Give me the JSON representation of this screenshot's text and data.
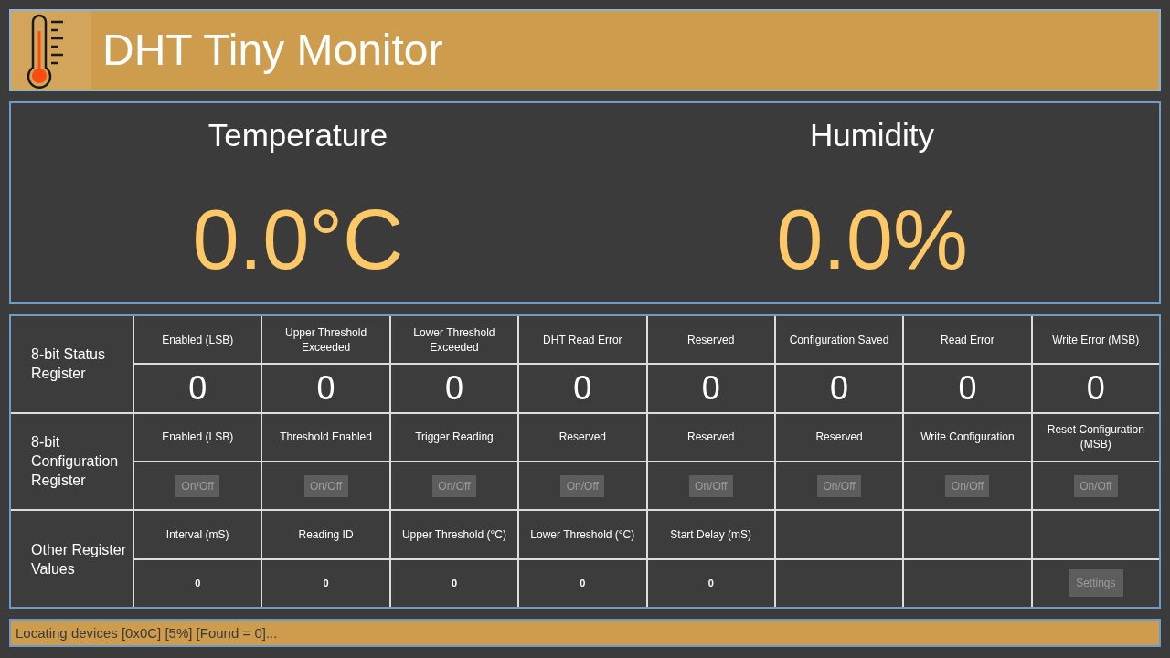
{
  "header": {
    "title": "DHT Tiny Monitor"
  },
  "readings": [
    {
      "label": "Temperature",
      "value": "0.0°C"
    },
    {
      "label": "Humidity",
      "value": "0.0%"
    }
  ],
  "registers": [
    {
      "kind": "status",
      "label": "8-bit Status Register",
      "bits": [
        {
          "name": "Enabled (LSB)",
          "value": "0"
        },
        {
          "name": "Upper Threshold Exceeded",
          "value": "0"
        },
        {
          "name": "Lower Threshold Exceeded",
          "value": "0"
        },
        {
          "name": "DHT Read Error",
          "value": "0"
        },
        {
          "name": "Reserved",
          "value": "0"
        },
        {
          "name": "Configuration Saved",
          "value": "0"
        },
        {
          "name": "Read Error",
          "value": "0"
        },
        {
          "name": "Write Error (MSB)",
          "value": "0"
        }
      ]
    },
    {
      "kind": "config",
      "label": "8-bit Configuration Register",
      "bits": [
        {
          "name": "Enabled (LSB)",
          "button": "On/Off",
          "disabled": true
        },
        {
          "name": "Threshold Enabled",
          "button": "On/Off",
          "disabled": true
        },
        {
          "name": "Trigger Reading",
          "button": "On/Off",
          "disabled": true
        },
        {
          "name": "Reserved",
          "button": "On/Off",
          "disabled": true
        },
        {
          "name": "Reserved",
          "button": "On/Off",
          "disabled": true
        },
        {
          "name": "Reserved",
          "button": "On/Off",
          "disabled": true
        },
        {
          "name": "Write Configuration",
          "button": "On/Off",
          "disabled": true
        },
        {
          "name": "Reset Configuration (MSB)",
          "button": "On/Off",
          "disabled": true
        }
      ]
    },
    {
      "kind": "other",
      "label": "Other Register Values",
      "bits": [
        {
          "name": "Interval (mS)",
          "value": "0"
        },
        {
          "name": "Reading ID",
          "value": "0"
        },
        {
          "name": "Upper Threshold (°C)",
          "value": "0"
        },
        {
          "name": "Lower Threshold (°C)",
          "value": "0"
        },
        {
          "name": "Start Delay (mS)",
          "value": "0"
        }
      ],
      "button": {
        "label": "Settings",
        "disabled": true
      }
    }
  ],
  "status_bar": {
    "text": "Locating devices [0x0C] [5%] [Found = 0]..."
  }
}
